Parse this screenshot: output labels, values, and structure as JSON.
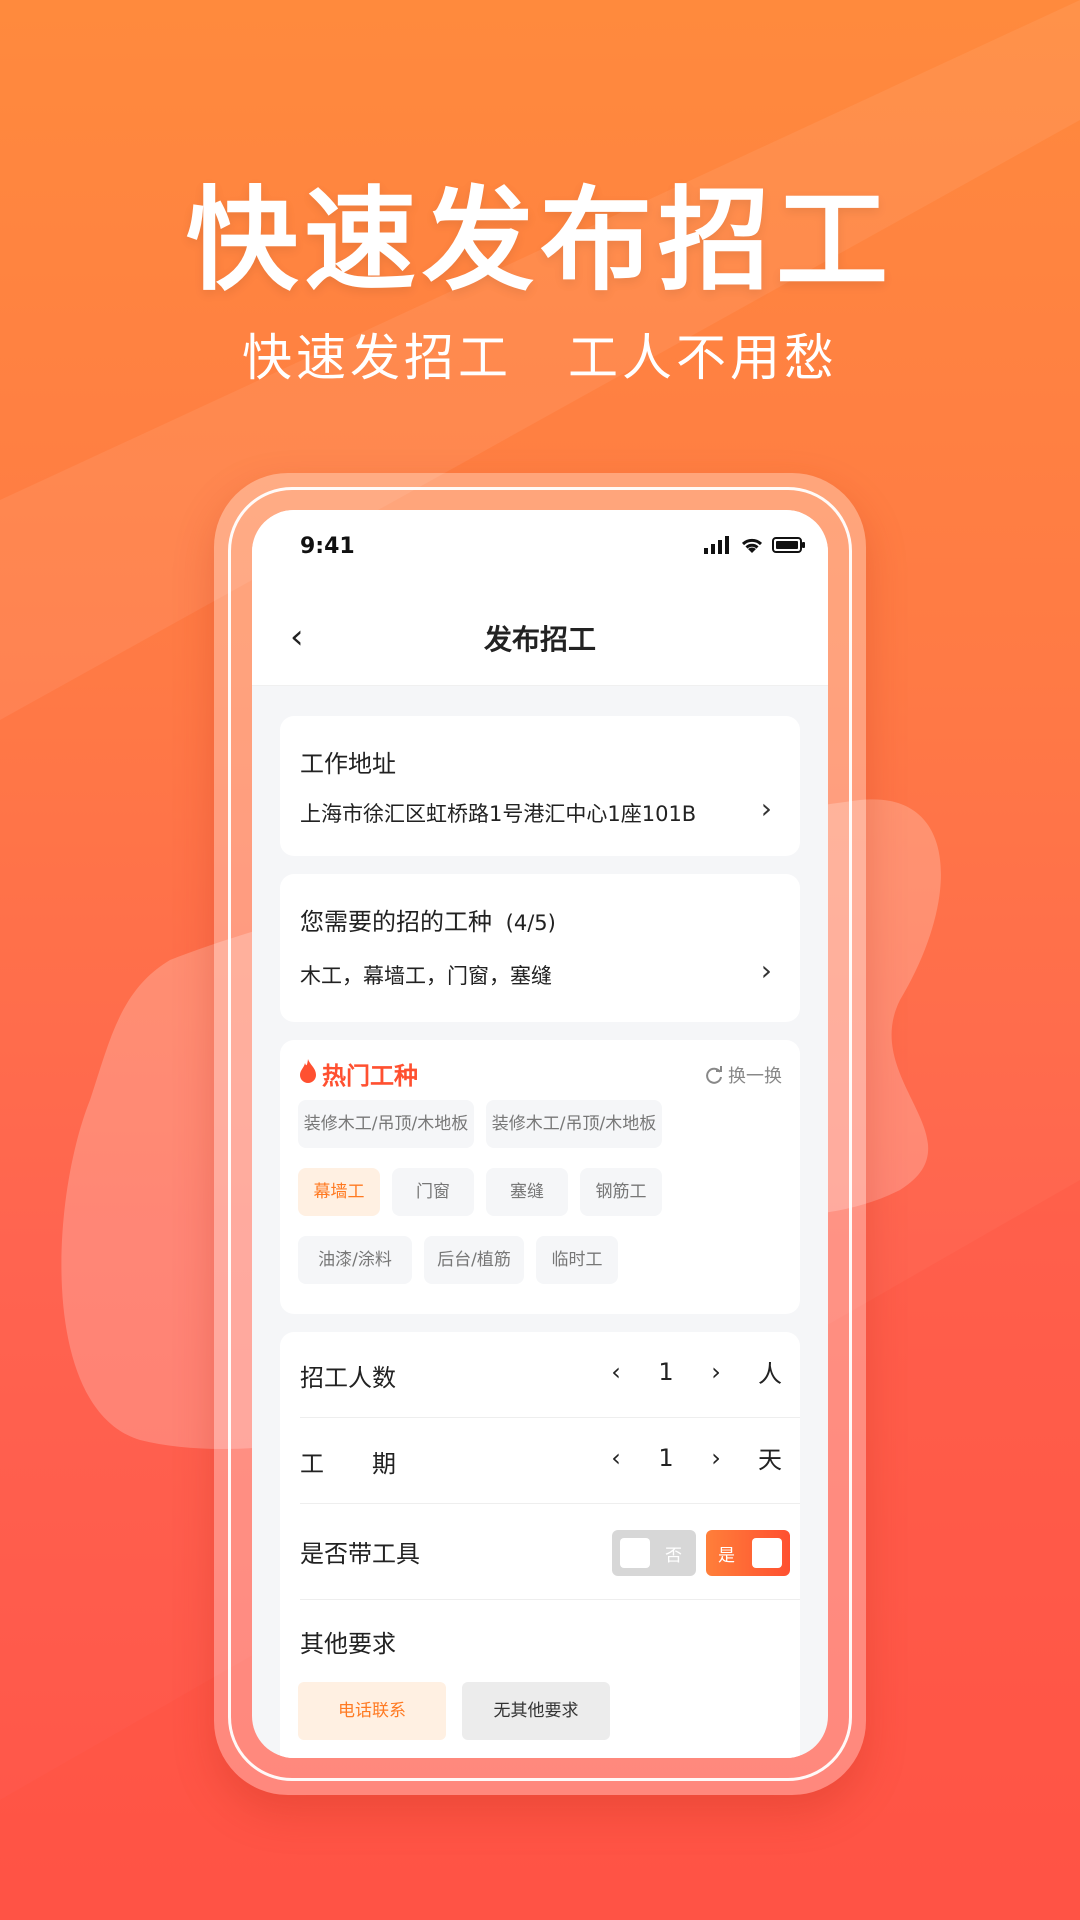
{
  "headline": "快速发布招工",
  "subline": [
    "快速发招工",
    "工人不用愁"
  ],
  "status_bar": {
    "time": "9:41"
  },
  "nav": {
    "title": "发布招工"
  },
  "address": {
    "label": "工作地址",
    "value": "上海市徐汇区虹桥路1号港汇中心1座101B"
  },
  "trade": {
    "label": "您需要的招的工种",
    "count": "(4/5)",
    "value": "木工，幕墙工，门窗，塞缝"
  },
  "hot": {
    "title": "热门工种",
    "refresh": "换一换",
    "tags": [
      {
        "label": "装修木工/吊顶/木地板",
        "active": false
      },
      {
        "label": "装修木工/吊顶/木地板",
        "active": false
      },
      {
        "label": "幕墙工",
        "active": true
      },
      {
        "label": "门窗",
        "active": false
      },
      {
        "label": "塞缝",
        "active": false
      },
      {
        "label": "钢筋工",
        "active": false
      },
      {
        "label": "油漆/涂料",
        "active": false
      },
      {
        "label": "后台/植筋",
        "active": false
      },
      {
        "label": "临时工",
        "active": false
      }
    ]
  },
  "form": {
    "workers": {
      "label": "招工人数",
      "value": "1",
      "unit": "人"
    },
    "period": {
      "label": "工　　期",
      "value": "1",
      "unit": "天"
    },
    "tools": {
      "label": "是否带工具",
      "off_label": "否",
      "on_label": "是"
    },
    "other": {
      "label": "其他要求",
      "options": [
        "电话联系",
        "无其他要求"
      ]
    }
  },
  "colors": {
    "accent": "#ff5030",
    "active_tag_bg": "#fff0e2",
    "active_tag_text": "#ff7a22"
  }
}
